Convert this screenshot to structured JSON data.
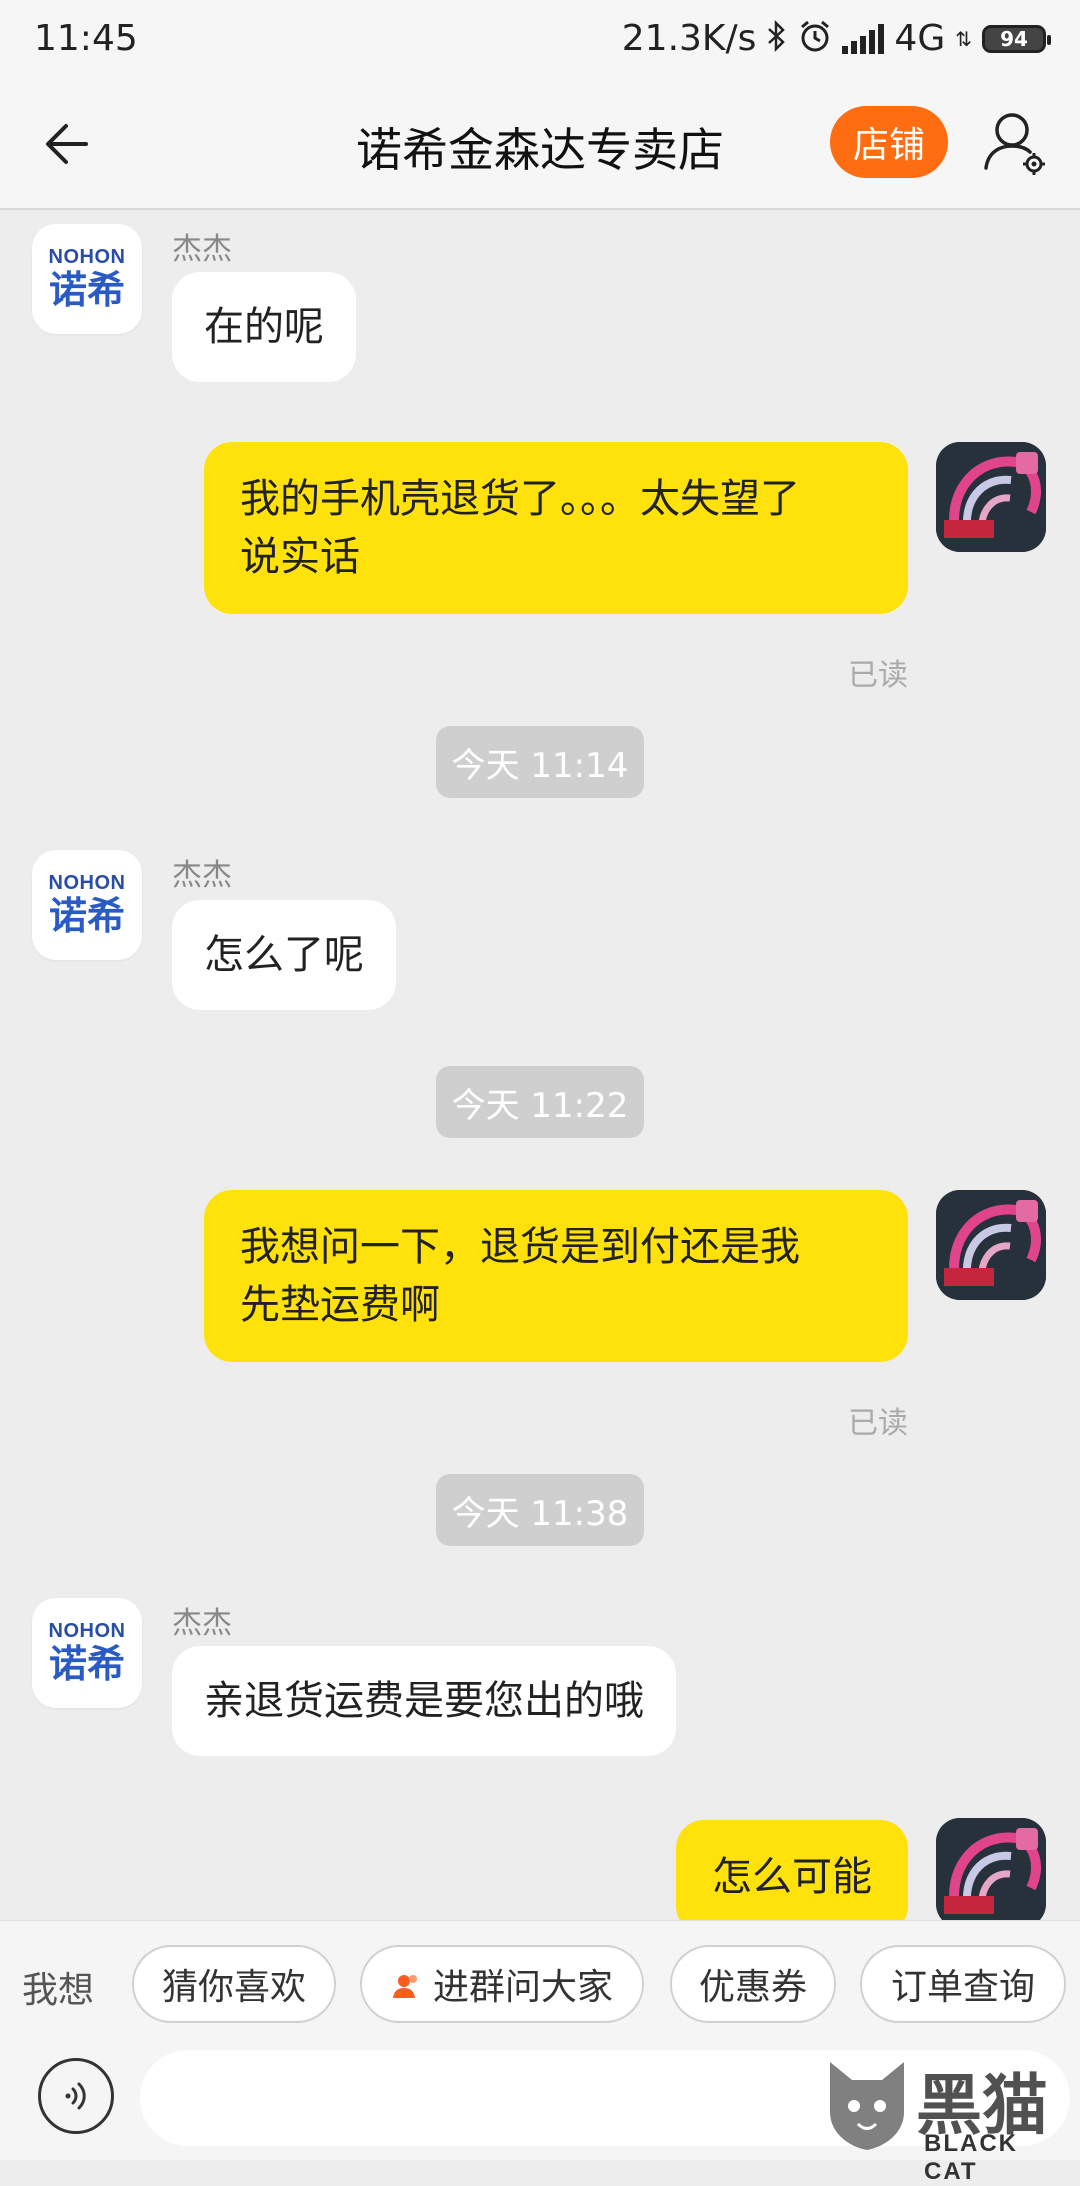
{
  "status_bar": {
    "time": "11:45",
    "net_speed": "21.3K/s",
    "network": "4G",
    "battery": "94"
  },
  "header": {
    "title": "诺希金森达专卖店",
    "shop_button": "店铺"
  },
  "shop_avatar": {
    "en": "NOHON",
    "cn": "诺希"
  },
  "messages": [
    {
      "side": "left",
      "sender": "杰杰",
      "text": "在的呢"
    },
    {
      "side": "right",
      "text": "我的手机壳退货了。。。太失望了\n说实话",
      "status": "已读"
    },
    {
      "time": "今天  11:14"
    },
    {
      "side": "left",
      "sender": "杰杰",
      "text": "怎么了呢"
    },
    {
      "time": "今天  11:22"
    },
    {
      "side": "right",
      "text": "我想问一下，退货是到付还是我\n先垫运费啊",
      "status": "已读"
    },
    {
      "time": "今天  11:38"
    },
    {
      "side": "left",
      "sender": "杰杰",
      "text": "亲退货运费是要您出的哦"
    },
    {
      "side": "right",
      "text": "怎么可能"
    }
  ],
  "quick_bar": {
    "label": "我想",
    "chips": [
      "猜你喜欢",
      "进群问大家",
      "优惠券",
      "订单查询"
    ]
  },
  "input": {
    "value": ""
  },
  "watermark": {
    "text": "BLACK CAT",
    "big": "黑猫"
  },
  "colors": {
    "accent": "#ff6d12",
    "my_bubble": "#ffe20c",
    "background": "#ededed"
  }
}
